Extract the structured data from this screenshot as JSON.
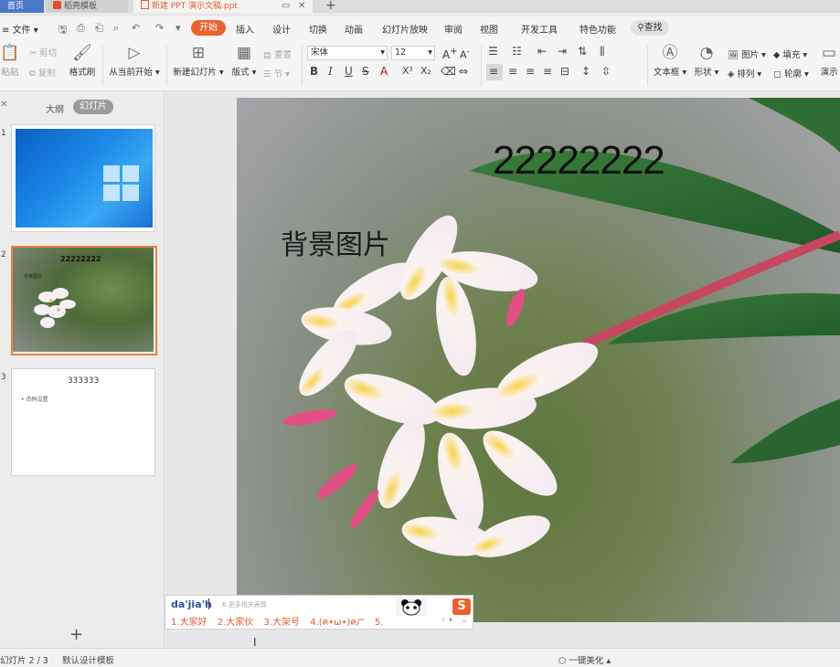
{
  "tabs": {
    "home": "首页",
    "docer": "稻壳模板",
    "document": "新建 PPT 演示文稿.ppt"
  },
  "menu": {
    "file": "文件",
    "items": [
      "开始",
      "插入",
      "设计",
      "切换",
      "动画",
      "幻灯片放映",
      "审阅",
      "视图",
      "开发工具",
      "特色功能"
    ],
    "active": "开始",
    "search": "查找"
  },
  "ribbon": {
    "paste": "粘贴",
    "cut": "剪切",
    "copy": "复制",
    "format_painter": "格式刷",
    "play_from_current": "从当前开始",
    "new_slide": "新建幻灯片",
    "layout": "版式",
    "reset": "重置",
    "section": "节",
    "font_name": "宋体",
    "font_size": "12",
    "textbox": "文本框",
    "shape": "形状",
    "picture": "图片",
    "fill": "填充",
    "arrange": "排列",
    "outline": "轮廓",
    "present": "演示"
  },
  "panel": {
    "outline_tab": "大纲",
    "slides_tab": "幻灯片",
    "slides": [
      {
        "num": "1"
      },
      {
        "num": "2",
        "title": "22222222",
        "text": "背景图片"
      },
      {
        "num": "3",
        "title": "333333",
        "bullet": "页码设置"
      }
    ]
  },
  "slide": {
    "title": "22222222",
    "body": "背景图片"
  },
  "ime": {
    "input": "da'jia'h",
    "hint": "6.更多相关表情",
    "candidates": [
      "1.大家好",
      "2.大家伙",
      "3.大架号",
      "4.(ฅ•ω•)ฅ/”",
      "5."
    ],
    "logo": "S"
  },
  "status": {
    "slide_indicator": "幻灯片 2 / 3",
    "theme": "默认设计模板",
    "beautify": "一键美化"
  },
  "colors": {
    "accent": "#e9612d",
    "home_tab": "#4a78c9",
    "selected_thumb_border": "#e9823a",
    "ime_candidate": "#e05a32"
  }
}
